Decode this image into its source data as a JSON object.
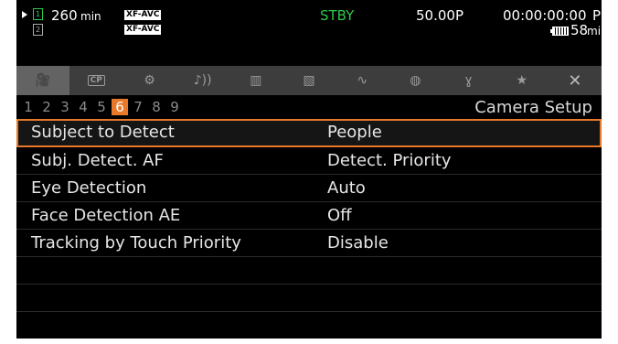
{
  "status": {
    "rec_time_value": "260",
    "rec_time_unit": "min",
    "slot1": "1",
    "slot2": "2",
    "codec_1": "XF-AVC",
    "codec_2": "XF-AVC",
    "mode": "STBY",
    "frame_rate": "50.00P",
    "timecode": "00:00:00:00",
    "timecode_suffix": "P",
    "battery_value": "58",
    "battery_unit": "min"
  },
  "tabs": [
    {
      "icon": "camera-icon",
      "glyph": "🎥",
      "active": true
    },
    {
      "icon": "custom-picture-icon",
      "label": "CP"
    },
    {
      "icon": "recording-setup-icon",
      "glyph": "⚙"
    },
    {
      "icon": "audio-icon",
      "glyph": "♪))"
    },
    {
      "icon": "video-setup-icon",
      "glyph": "▥"
    },
    {
      "icon": "lcd-viewfinder-icon",
      "glyph": "▧"
    },
    {
      "icon": "tc-ub-icon",
      "glyph": "∿"
    },
    {
      "icon": "network-icon",
      "glyph": "◍"
    },
    {
      "icon": "system-setup-icon",
      "glyph": "ɣ"
    },
    {
      "icon": "my-menu-star-icon",
      "glyph": "★"
    },
    {
      "icon": "close-icon",
      "glyph": "✕"
    }
  ],
  "pages": [
    "1",
    "2",
    "3",
    "4",
    "5",
    "6",
    "7",
    "8",
    "9"
  ],
  "active_page": "6",
  "section_title": "Camera Setup",
  "menu": [
    {
      "label": "Subject to Detect",
      "value": "People",
      "selected": true
    },
    {
      "label": "Subj. Detect. AF",
      "value": "Detect. Priority"
    },
    {
      "label": "Eye Detection",
      "value": "Auto"
    },
    {
      "label": "Face Detection AE",
      "value": "Off"
    },
    {
      "label": "Tracking by Touch Priority",
      "value": "Disable"
    },
    {
      "label": "",
      "value": ""
    },
    {
      "label": "",
      "value": ""
    },
    {
      "label": "",
      "value": ""
    }
  ],
  "colors": {
    "accent": "#e8782a",
    "status_green": "#2ec84a",
    "tab_bar": "#3d3d3d",
    "tab_active": "#636363"
  }
}
